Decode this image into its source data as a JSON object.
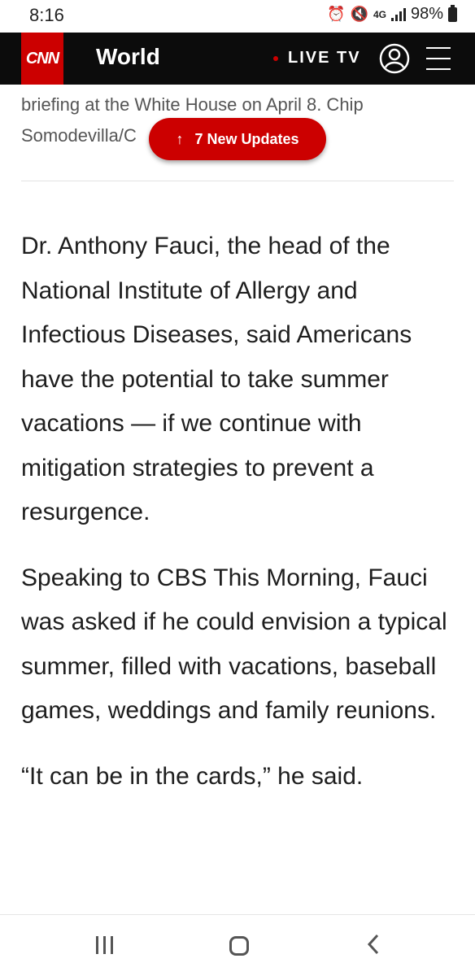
{
  "status_bar": {
    "time": "8:16",
    "network": "4G",
    "battery": "98%"
  },
  "header": {
    "logo": "CNN",
    "section": "World",
    "live_tv": "LIVE TV",
    "colors": {
      "brand": "#cc0000",
      "bar": "#0c0c0c"
    }
  },
  "caption": {
    "line1": "briefing at the White House on April 8. Chip",
    "line2": "Somodevilla/C"
  },
  "updates_pill": {
    "arrow": "↑",
    "label": "7 New Updates"
  },
  "article": {
    "paragraphs": [
      "Dr. Anthony Fauci, the head of the National Institute of Allergy and Infectious Diseases, said Americans have the potential to take summer vacations — if we continue with mitigation strategies to prevent a resurgence.",
      "Speaking to CBS This Morning, Fauci was asked if he could envision a typical summer, filled with vacations, baseball games, weddings and family reunions.",
      "“It can be in the cards,” he said."
    ]
  },
  "icons": {
    "alarm": "alarm-icon",
    "mute": "mute-icon",
    "account": "account-icon",
    "menu": "hamburger-menu-icon",
    "recents": "recents-icon",
    "home": "home-icon",
    "back": "back-icon"
  }
}
